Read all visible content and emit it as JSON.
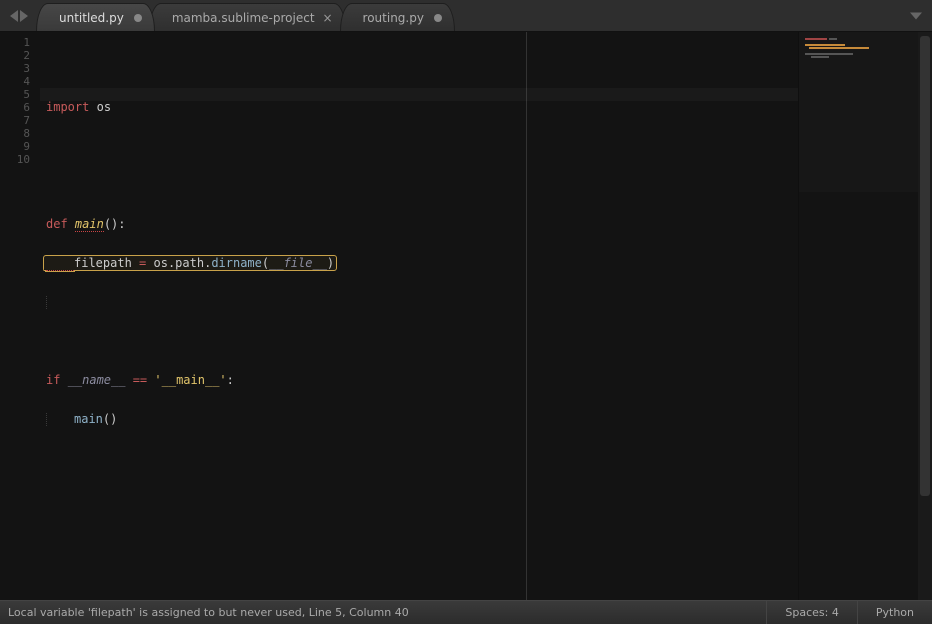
{
  "tabs": [
    {
      "label": "untitled.py",
      "dirty": true,
      "active": true
    },
    {
      "label": "mamba.sublime-project",
      "dirty": false,
      "active": false
    },
    {
      "label": "routing.py",
      "dirty": true,
      "active": false
    }
  ],
  "gutter": {
    "lines": [
      "1",
      "2",
      "3",
      "4",
      "5",
      "6",
      "7",
      "8",
      "9",
      "10"
    ],
    "warning_line": 5
  },
  "code": {
    "l1": {
      "import": "import",
      "mod": "os"
    },
    "l4": {
      "def": "def",
      "name": "main",
      "parens": "()",
      "colon": ":"
    },
    "l5": {
      "var": "filepath",
      "eq": " = ",
      "obj": "os",
      "dot1": ".",
      "mem1": "path",
      "dot2": ".",
      "mem2": "dirname",
      "lp": "(",
      "dunder": "__file__",
      "rp": ")"
    },
    "l8": {
      "if": "if",
      "name": "__name__",
      "eqeq": " == ",
      "str": "'__main__'",
      "colon": ":"
    },
    "l9": {
      "call": "main",
      "parens": "()"
    }
  },
  "status": {
    "message": "Local variable 'filepath' is assigned to but never used, Line 5, Column 40",
    "indent": "Spaces: 4",
    "syntax": "Python"
  }
}
